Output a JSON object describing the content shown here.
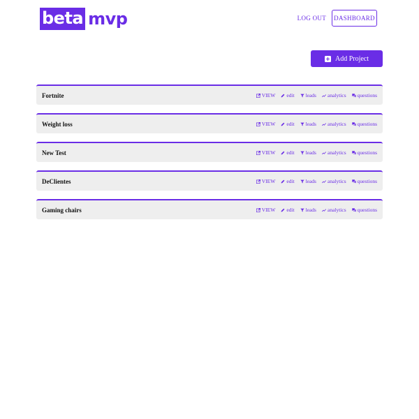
{
  "brand": {
    "logo_part1": "beta",
    "logo_part2": "mvp",
    "accent_color": "#6a2de6"
  },
  "nav": {
    "logout_label": "LOG OUT",
    "dashboard_label": "DASHBOARD"
  },
  "toolbar": {
    "add_project_label": "Add Project",
    "add_project_icon": "plus-square-icon"
  },
  "actions_labels": {
    "view": "VIEW",
    "edit": "edit",
    "leads": "leads",
    "analytics": "analytics",
    "questions": "questions"
  },
  "projects": [
    {
      "name": "Fortnite"
    },
    {
      "name": "Weight loss"
    },
    {
      "name": "New Test"
    },
    {
      "name": "DeClientes"
    },
    {
      "name": "Gaming chairs"
    }
  ]
}
